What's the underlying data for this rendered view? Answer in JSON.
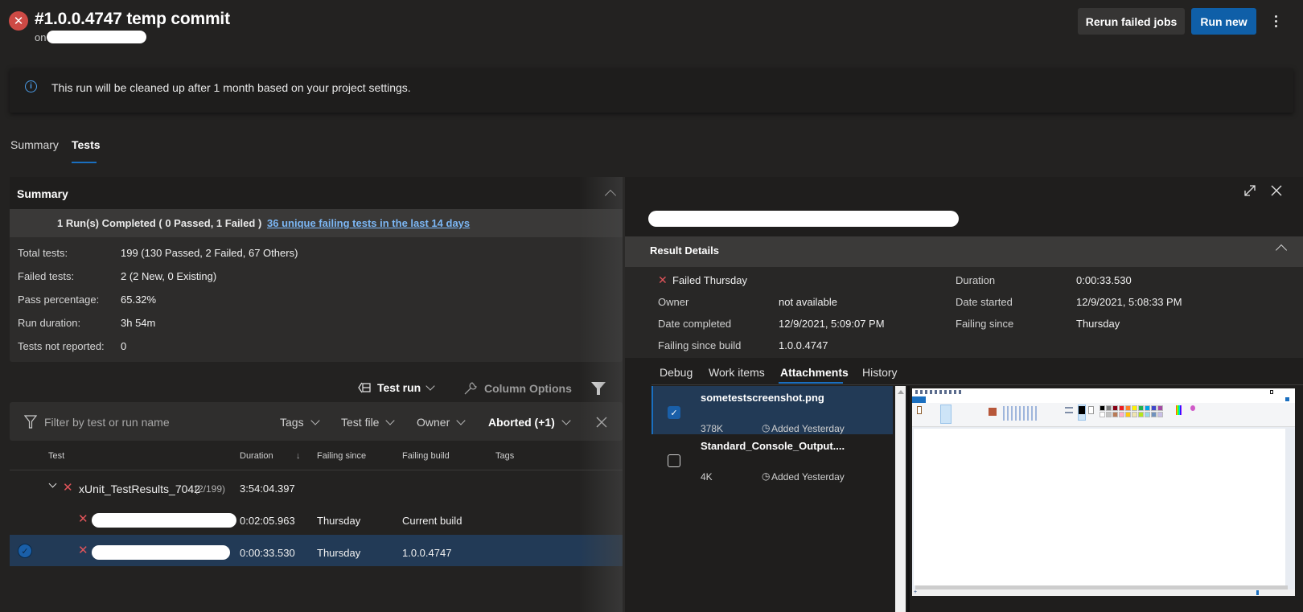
{
  "header": {
    "status": "failed",
    "title": "#1.0.0.4747 temp commit",
    "on_prefix": "on",
    "rerun_button": "Rerun failed jobs",
    "run_new_button": "Run new"
  },
  "banner": {
    "text": "This run will be cleaned up after 1 month based on your project settings."
  },
  "page_tabs": [
    {
      "label": "Summary",
      "active": false
    },
    {
      "label": "Tests",
      "active": true
    }
  ],
  "summary": {
    "title": "Summary",
    "runs_completed": "1 Run(s) Completed ( 0 Passed, 1 Failed )",
    "failing_link": "36 unique failing tests in the last 14 days",
    "stats": [
      {
        "label": "Total tests:",
        "value": "199 (130 Passed, 2 Failed, 67 Others)"
      },
      {
        "label": "Failed tests:",
        "value": "2 (2 New, 0 Existing)"
      },
      {
        "label": "Pass percentage:",
        "value": "65.32%"
      },
      {
        "label": "Run duration:",
        "value": "3h 54m"
      },
      {
        "label": "Tests not reported:",
        "value": "0"
      }
    ]
  },
  "toolbar": {
    "group_by": "Test run",
    "column_options": "Column Options"
  },
  "filter": {
    "placeholder": "Filter by test or run name",
    "dropdowns": [
      {
        "label": "Tags",
        "bold": false
      },
      {
        "label": "Test file",
        "bold": false
      },
      {
        "label": "Owner",
        "bold": false
      },
      {
        "label": "Aborted (+1)",
        "bold": true
      }
    ]
  },
  "table": {
    "columns": [
      "Test",
      "Duration",
      "Failing since",
      "Failing build",
      "Tags"
    ],
    "sort_indicator": "↓",
    "group": {
      "name": "xUnit_TestResults_7042",
      "count": "(2/199)",
      "duration": "3:54:04.397"
    },
    "rows": [
      {
        "duration": "0:02:05.963",
        "failing_since": "Thursday",
        "failing_build": "Current build",
        "selected": false
      },
      {
        "duration": "0:00:33.530",
        "failing_since": "Thursday",
        "failing_build": "1.0.0.4747",
        "selected": true
      }
    ]
  },
  "result_details": {
    "title": "Result Details",
    "outcome": "Failed Thursday",
    "left": [
      {
        "label": "Owner",
        "value": "not available"
      },
      {
        "label": "Date completed",
        "value": "12/9/2021, 5:09:07 PM"
      },
      {
        "label": "Failing since build",
        "value": "1.0.0.4747"
      }
    ],
    "right": [
      {
        "label": "Duration",
        "value": "0:00:33.530"
      },
      {
        "label": "Date started",
        "value": "12/9/2021, 5:08:33 PM"
      },
      {
        "label": "Failing since",
        "value": "Thursday"
      }
    ]
  },
  "detail_tabs": [
    {
      "label": "Debug",
      "active": false
    },
    {
      "label": "Work items",
      "active": false
    },
    {
      "label": "Attachments",
      "active": true
    },
    {
      "label": "History",
      "active": false
    }
  ],
  "attachments": [
    {
      "name": "sometestscreenshot.png",
      "size": "378K",
      "added": "Added Yesterday",
      "checked": true
    },
    {
      "name": "Standard_Console_Output....",
      "size": "4K",
      "added": "Added Yesterday",
      "checked": false
    }
  ],
  "colors": {
    "accent": "#0f5fa8",
    "failed": "#e0545a",
    "link": "#7cb7f5",
    "selected_row": "#223a56"
  }
}
